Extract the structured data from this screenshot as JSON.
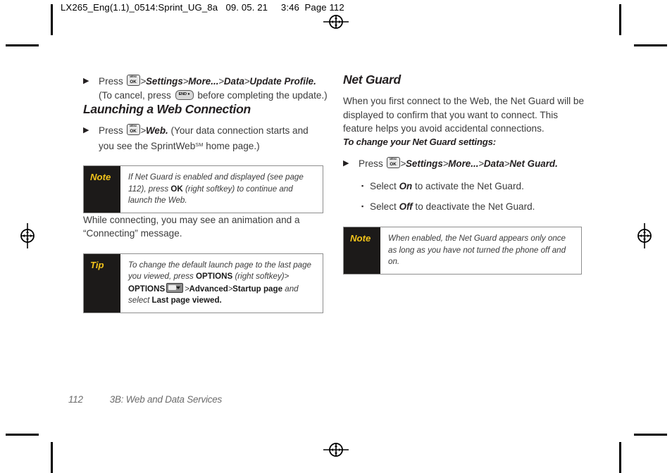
{
  "header": {
    "text": "LX265_Eng(1.1)_0514:Sprint_UG_8a   09. 05. 21     3:46  Page 112"
  },
  "left_column": {
    "update_profile_step": {
      "arrow": "▶",
      "press_label": "Press",
      "key_ok": "menu-ok-key-icon",
      "path": [
        "Settings",
        "More...",
        "Data",
        "Update Profile."
      ],
      "separator": ">",
      "cancel_prefix": "(To cancel, press",
      "key_end": "end-key-icon",
      "cancel_suffix": "before completing the update.)"
    },
    "section_heading": "Launching a Web Connection",
    "web_step": {
      "arrow": "▶",
      "press_label": "Press",
      "key_ok": "menu-ok-key-icon",
      "separator": ">",
      "target": "Web.",
      "trailing_line1": "(Your data connection starts and",
      "trailing_line2_pre": "you see the SprintWeb",
      "trailing_line2_sup": "SM",
      "trailing_line2_post": " home page.)"
    },
    "note_box": {
      "label": "Note",
      "text_line1_pre": "If Net Guard is enabled and displayed (see page",
      "text_line2_pre": "112), press ",
      "text_line2_bold": "OK",
      "text_line2_post": " (right softkey) to continue and",
      "text_line3": "launch the Web."
    },
    "connecting_paragraph": "While connecting, you may see an animation and a “Connecting” message.",
    "tip_box": {
      "label": "Tip",
      "line1": "To change the default launch page to the last",
      "line2_pre": "page you viewed, press ",
      "line2_bold": "OPTIONS",
      "line2_post": " (right softkey)",
      "line2_sep": ">",
      "line3_bold1": "OPTIONS",
      "line3_key": "softkey-icon",
      "line3_sep1": ">",
      "line3_bold2": "Advanced",
      "line3_sep2": ">",
      "line3_bold3": "Startup page",
      "line3_italic": " and",
      "line4_pre": "select ",
      "line4_bold": "Last page viewed."
    }
  },
  "right_column": {
    "section_heading": "Net Guard",
    "intro_paragraph": "When you first connect to the Web, the Net Guard will be displayed to confirm that you want to connect. This feature helps you avoid accidental connections.",
    "settings_lead": "To change your Net Guard settings:",
    "settings_step": {
      "arrow": "▶",
      "press_label": "Press",
      "key_ok": "menu-ok-key-icon",
      "separator": ">",
      "path": [
        "Settings",
        "More...",
        "Data",
        "Net Guard."
      ]
    },
    "bullets": [
      {
        "glyph": "▪",
        "pre": "Select ",
        "emphasis": "On",
        "post": " to activate the Net Guard."
      },
      {
        "glyph": "▪",
        "pre": "Select ",
        "emphasis": "Off",
        "post": " to deactivate the Net Guard."
      }
    ],
    "note_box": {
      "label": "Note",
      "line1": "When enabled, the Net Guard appears only once",
      "line2": "as long as you have not turned the phone off",
      "line3": "and on."
    }
  },
  "footer": {
    "page_number": "112",
    "chapter_title": "3B: Web and Data Services"
  },
  "colors": {
    "callout_bg": "#1c1a19",
    "callout_label_text": "#f2c31a",
    "body_text": "#3b3b3b",
    "heading_text": "#231f20",
    "footer_text": "#6b6b6b"
  },
  "print_marks": {
    "registration_targets": 4,
    "crop_bars": 4,
    "trim_bars": 4
  }
}
